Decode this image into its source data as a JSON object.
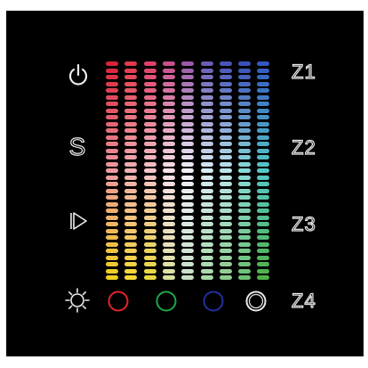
{
  "colors": {
    "panel": "#000000",
    "outline": "#eaeaea",
    "red": "#e0242a",
    "green": "#1fa64a",
    "blue": "#2230a0",
    "white": "#e8e8e8"
  },
  "left_buttons": [
    {
      "name": "power-icon",
      "glyph": "power"
    },
    {
      "name": "s-button",
      "label": "S"
    },
    {
      "name": "play-icon",
      "glyph": "play"
    },
    {
      "name": "brightness-icon",
      "glyph": "sun"
    }
  ],
  "zones": [
    {
      "id": "z1",
      "label": "Z1"
    },
    {
      "id": "z2",
      "label": "Z2"
    },
    {
      "id": "z3",
      "label": "Z3"
    },
    {
      "id": "z4",
      "label": "Z4"
    }
  ],
  "channels": [
    {
      "id": "red",
      "color": "#e0242a"
    },
    {
      "id": "green",
      "color": "#1fa64a"
    },
    {
      "id": "blue",
      "color": "#2230a0"
    },
    {
      "id": "white",
      "color": "#e8e8e8"
    }
  ],
  "color_wheel": {
    "top_colors": [
      "#d9243a",
      "#e03a4e",
      "#e0406a",
      "#c8508a",
      "#9a5aa8",
      "#6a5cb4",
      "#4a54b8",
      "#3a50b8",
      "#3458c0"
    ],
    "mid_colors": [
      "#ee9aa0",
      "#f0b0b4",
      "#f4c4c8",
      "#f8e0e8",
      "#f0f0f8",
      "#d8eaf4",
      "#bce6ec",
      "#8ad8d8",
      "#56c8c8"
    ],
    "bottom_colors": [
      "#f0d020",
      "#f4d838",
      "#e8d840",
      "#dce0a0",
      "#c8e0c8",
      "#a8d8a8",
      "#8ccc8c",
      "#6cc070",
      "#50b048"
    ]
  }
}
